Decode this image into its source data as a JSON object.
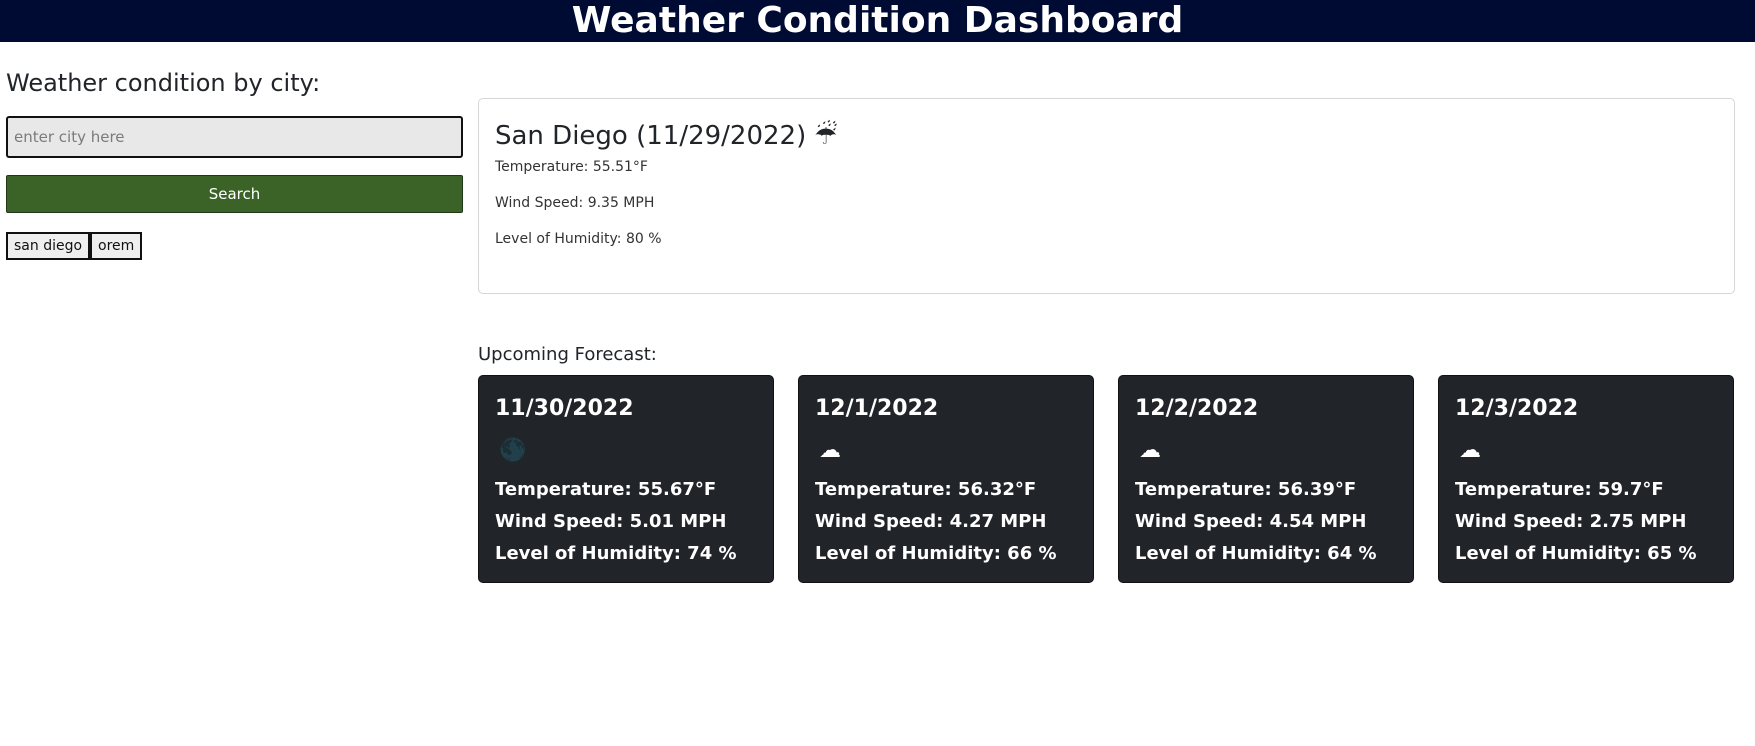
{
  "header": {
    "title": "Weather Condition Dashboard"
  },
  "sidebar": {
    "heading": "Weather condition by city:",
    "search_placeholder": "enter city here",
    "search_value": "",
    "search_button": "Search",
    "history": [
      "san diego",
      "orem"
    ]
  },
  "current": {
    "title": "San Diego (11/29/2022)",
    "icon": "☔",
    "icon_name": "rain-cloud-icon",
    "temperature": "Temperature: 55.51°F",
    "wind": "Wind Speed: 9.35 MPH",
    "humidity": "Level of Humidity: 80 %"
  },
  "forecast": {
    "label": "Upcoming Forecast:",
    "days": [
      {
        "date": "11/30/2022",
        "icon": "🌑",
        "icon_name": "clear-night-icon",
        "temperature": "Temperature: 55.67°F",
        "wind": "Wind Speed: 5.01 MPH",
        "humidity": "Level of Humidity: 74 %"
      },
      {
        "date": "12/1/2022",
        "icon": "☁",
        "icon_name": "broken-clouds-icon",
        "temperature": "Temperature: 56.32°F",
        "wind": "Wind Speed: 4.27 MPH",
        "humidity": "Level of Humidity: 66 %"
      },
      {
        "date": "12/2/2022",
        "icon": "☁",
        "icon_name": "overcast-clouds-icon",
        "temperature": "Temperature: 56.39°F",
        "wind": "Wind Speed: 4.54 MPH",
        "humidity": "Level of Humidity: 64 %"
      },
      {
        "date": "12/3/2022",
        "icon": "☁",
        "icon_name": "broken-clouds-icon",
        "temperature": "Temperature: 59.7°F",
        "wind": "Wind Speed: 2.75 MPH",
        "humidity": "Level of Humidity: 65 %"
      }
    ]
  },
  "colors": {
    "header_bg": "#000b33",
    "search_button_bg": "#3b6328",
    "card_bg": "#212529"
  }
}
